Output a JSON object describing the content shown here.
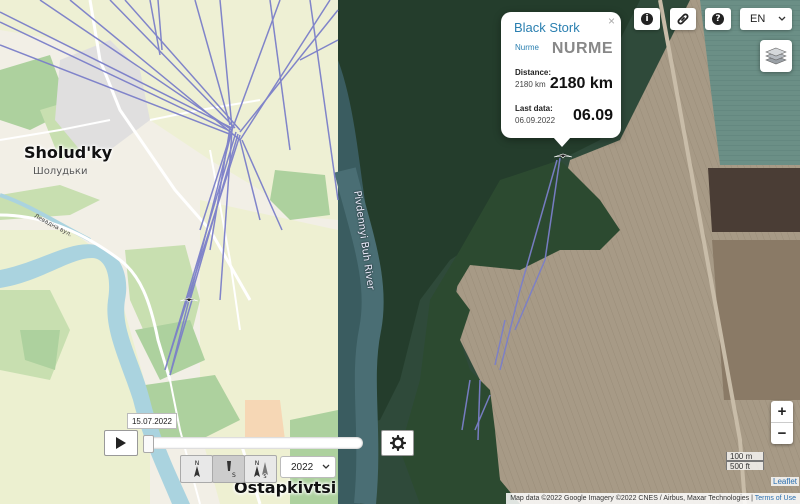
{
  "map": {
    "places": [
      {
        "name": "Sholud'ky",
        "native": "Шолудьки"
      },
      {
        "name": "Ostapkivtsi"
      }
    ],
    "river": "Pivdennyi Buh River",
    "road": "Левадна вул."
  },
  "popup": {
    "species": "Black Stork",
    "name_small": "Nurme",
    "name_big": "NURME",
    "distance_label": "Distance:",
    "distance_small": "2180 km",
    "distance_big": "2180 km",
    "last_data_label": "Last data:",
    "last_data_small": "06.09.2022",
    "last_data_big": "06.09",
    "close": "×"
  },
  "controls": {
    "icons": [
      "info-icon",
      "link-icon",
      "help-icon",
      "layers-icon",
      "play-icon",
      "gear-icon"
    ],
    "language": "EN",
    "zoom_in": "+",
    "zoom_out": "−",
    "scale_m": "100 m",
    "scale_ft": "500 ft",
    "attribution": "Map data ©2022 Google Imagery ©2022 CNES / Airbus, Maxar Technologies",
    "terms": "Terms of Use",
    "leaflet": "Leaflet"
  },
  "timeline": {
    "date": "15.07.2022",
    "year": "2022",
    "position": 0.0
  },
  "colors": {
    "track": "#7b7fc9",
    "popup_title": "#2a7fb0"
  }
}
